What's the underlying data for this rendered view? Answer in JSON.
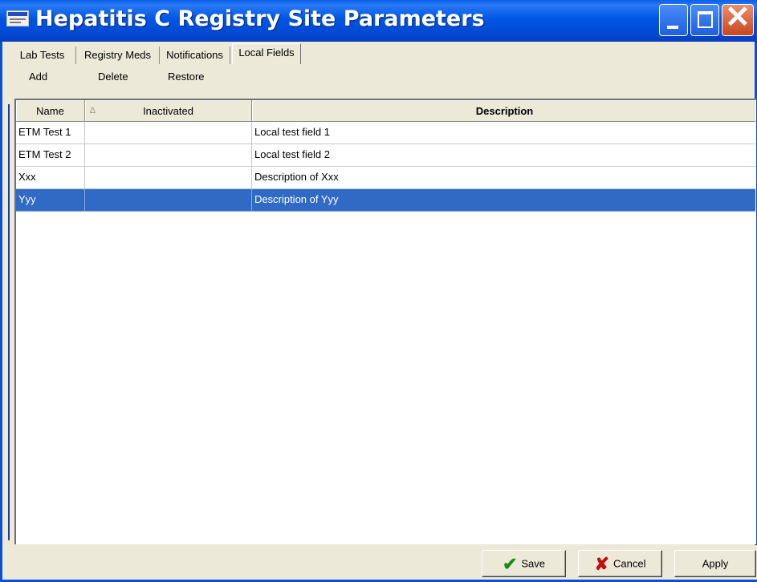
{
  "window": {
    "title": "Hepatitis C Registry Site Parameters",
    "controls": {
      "minimize_icon": "minimize-icon",
      "maximize_icon": "maximize-icon",
      "close_icon": "close-icon",
      "close_glyph": "✕"
    }
  },
  "tabs": [
    {
      "label": "Lab Tests",
      "active": false
    },
    {
      "label": "Registry Meds",
      "active": false
    },
    {
      "label": "Notifications",
      "active": false
    },
    {
      "label": "Local Fields",
      "active": true
    }
  ],
  "toolbar": {
    "add_label": "Add",
    "delete_label": "Delete",
    "restore_label": "Restore"
  },
  "table": {
    "columns": [
      "Name",
      "Inactivated",
      "Description"
    ],
    "sort_indicator": "∆",
    "rows": [
      {
        "name": "ETM Test 1",
        "inactivated": "",
        "description": "Local test field 1",
        "selected": false
      },
      {
        "name": "ETM Test 2",
        "inactivated": "",
        "description": "Local test field 2",
        "selected": false
      },
      {
        "name": "Xxx",
        "inactivated": "",
        "description": "Description of Xxx",
        "selected": false
      },
      {
        "name": "Yyy",
        "inactivated": "",
        "description": "Description of Yyy",
        "selected": true
      }
    ]
  },
  "footer": {
    "save_label": "Save",
    "cancel_label": "Cancel",
    "apply_label": "Apply",
    "save_icon": "checkmark-icon",
    "cancel_icon": "x-mark-icon",
    "check_glyph": "✔",
    "x_glyph": "✘"
  },
  "colors": {
    "title_bar": "#0054e3",
    "selection": "#316ac5",
    "face": "#ece9d8",
    "close_button": "#c8461e"
  }
}
